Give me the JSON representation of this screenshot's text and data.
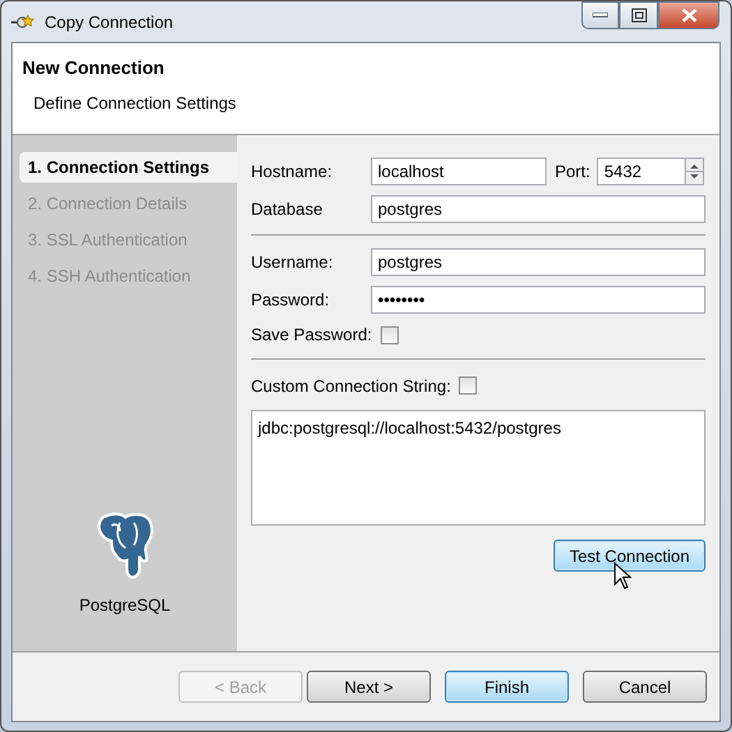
{
  "window": {
    "title": "Copy Connection"
  },
  "header": {
    "title": "New Connection",
    "subtitle": "Define Connection Settings"
  },
  "steps": [
    {
      "label": "1. Connection Settings",
      "selected": true
    },
    {
      "label": "2. Connection Details",
      "selected": false
    },
    {
      "label": "3. SSL Authentication",
      "selected": false
    },
    {
      "label": "4. SSH Authentication",
      "selected": false
    }
  ],
  "driver": {
    "name": "PostgreSQL"
  },
  "form": {
    "hostname": {
      "label": "Hostname:",
      "value": "localhost"
    },
    "port": {
      "label": "Port:",
      "value": "5432"
    },
    "database": {
      "label": "Database",
      "value": "postgres"
    },
    "username": {
      "label": "Username:",
      "value": "postgres"
    },
    "password": {
      "label": "Password:",
      "value": "••••••••"
    },
    "save_password": {
      "label": "Save Password:",
      "checked": false
    },
    "custom_connection_string": {
      "label": "Custom Connection String:",
      "checked": false
    },
    "connection_string": {
      "value": "jdbc:postgresql://localhost:5432/postgres"
    },
    "test_button": {
      "label": "Test Connection",
      "hovered": true
    }
  },
  "buttons": [
    {
      "label": "< Back",
      "disabled": true,
      "default": false
    },
    {
      "label": "Next >",
      "disabled": false,
      "default": false
    },
    {
      "label": "Finish",
      "disabled": false,
      "default": true
    },
    {
      "label": "Cancel",
      "disabled": false,
      "default": false
    }
  ]
}
